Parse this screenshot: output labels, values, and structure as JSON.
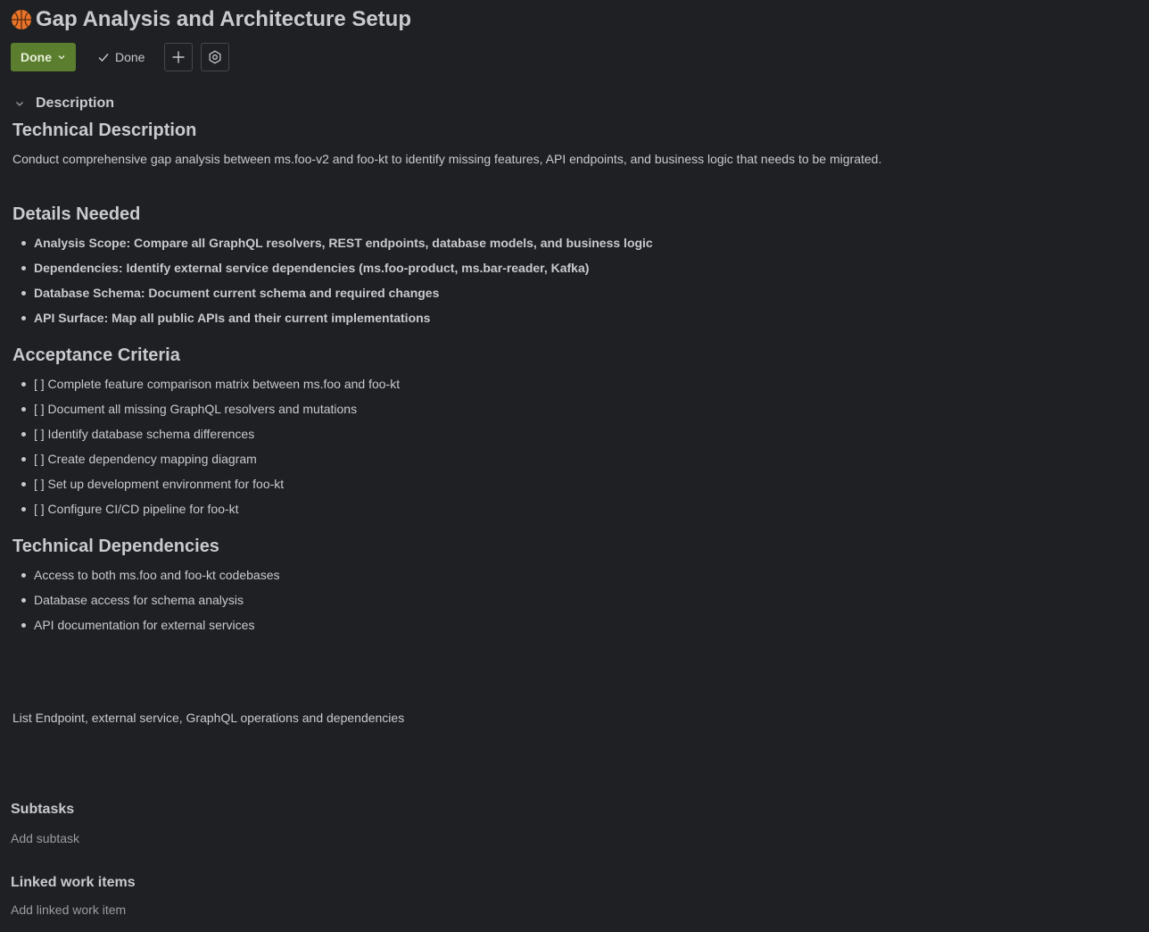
{
  "issue": {
    "title": "Gap Analysis and Architecture Setup",
    "type_icon": "basketball-icon"
  },
  "toolbar": {
    "status_label": "Done",
    "resolution_label": "Done",
    "status_color": "#5b7d2e"
  },
  "description": {
    "header": "Description",
    "technical_description": {
      "heading": "Technical Description",
      "text": "Conduct comprehensive gap analysis between ms.foo-v2 and foo-kt to identify missing features, API endpoints, and business logic that needs to be migrated."
    },
    "details_needed": {
      "heading": "Details Needed",
      "items": [
        "Analysis Scope: Compare all GraphQL resolvers, REST endpoints, database models, and business logic",
        "Dependencies: Identify external service dependencies (ms.foo-product, ms.bar-reader, Kafka)",
        "Database Schema: Document current schema and required changes",
        "API Surface: Map all public APIs and their current implementations"
      ]
    },
    "acceptance_criteria": {
      "heading": "Acceptance Criteria",
      "items": [
        "[ ] Complete feature comparison matrix between ms.foo and foo-kt",
        "[ ] Document all missing GraphQL resolvers and mutations",
        "[ ] Identify database schema differences",
        "[ ] Create dependency mapping diagram",
        "[ ] Set up development environment for foo-kt",
        "[ ] Configure CI/CD pipeline for foo-kt"
      ]
    },
    "technical_dependencies": {
      "heading": "Technical Dependencies",
      "items": [
        "Access to both ms.foo and foo-kt codebases",
        "Database access for schema analysis",
        "API documentation for external services"
      ]
    },
    "footer_note": "List Endpoint, external service, GraphQL operations and dependencies"
  },
  "subtasks": {
    "heading": "Subtasks",
    "add_label": "Add subtask"
  },
  "linked": {
    "heading": "Linked work items",
    "add_label": "Add linked work item"
  }
}
